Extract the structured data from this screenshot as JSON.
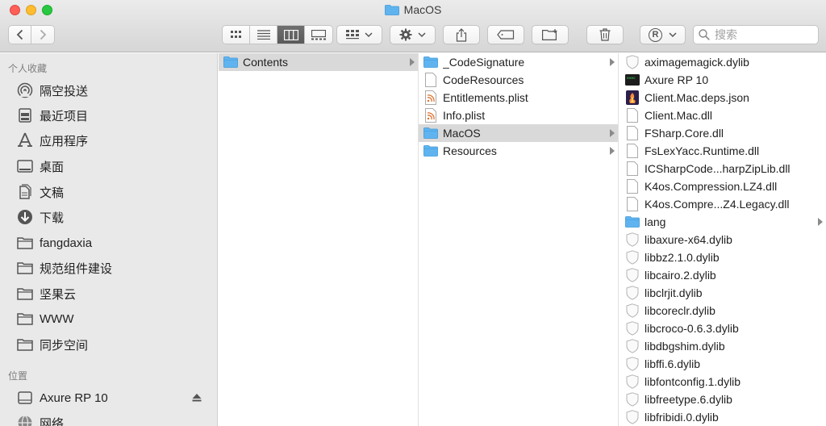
{
  "window": {
    "title": "MacOS"
  },
  "toolbar": {
    "search_placeholder": "搜索",
    "tag_letter": "R"
  },
  "sidebar": {
    "favorites_header": "个人收藏",
    "favorites": [
      {
        "label": "隔空投送",
        "icon": "airdrop-icon"
      },
      {
        "label": "最近项目",
        "icon": "recents-icon"
      },
      {
        "label": "应用程序",
        "icon": "applications-icon"
      },
      {
        "label": "桌面",
        "icon": "desktop-icon"
      },
      {
        "label": "文稿",
        "icon": "documents-icon"
      },
      {
        "label": "下载",
        "icon": "downloads-icon"
      },
      {
        "label": "fangdaxia",
        "icon": "folder-icon"
      },
      {
        "label": "规范组件建设",
        "icon": "folder-icon"
      },
      {
        "label": "坚果云",
        "icon": "folder-icon"
      },
      {
        "label": "WWW",
        "icon": "folder-icon"
      },
      {
        "label": "同步空间",
        "icon": "folder-icon"
      }
    ],
    "locations_header": "位置",
    "locations": [
      {
        "label": "Axure RP 10",
        "icon": "disk-icon"
      },
      {
        "label": "网络",
        "icon": "network-icon"
      }
    ]
  },
  "columns": {
    "col1": [
      {
        "label": "Contents",
        "type": "folder",
        "selected": true,
        "has_children": true
      }
    ],
    "col2": [
      {
        "label": "_CodeSignature",
        "type": "folder",
        "has_children": true
      },
      {
        "label": "CodeResources",
        "type": "file"
      },
      {
        "label": "Entitlements.plist",
        "type": "plist"
      },
      {
        "label": "Info.plist",
        "type": "plist"
      },
      {
        "label": "MacOS",
        "type": "folder",
        "selected": true,
        "has_children": true
      },
      {
        "label": "Resources",
        "type": "folder",
        "has_children": true
      }
    ],
    "col3": [
      {
        "label": "aximagemagick.dylib",
        "type": "dylib"
      },
      {
        "label": "Axure RP 10",
        "type": "exec"
      },
      {
        "label": "Client.Mac.deps.json",
        "type": "json"
      },
      {
        "label": "Client.Mac.dll",
        "type": "file"
      },
      {
        "label": "FSharp.Core.dll",
        "type": "file"
      },
      {
        "label": "FsLexYacc.Runtime.dll",
        "type": "file"
      },
      {
        "label": "ICSharpCode...harpZipLib.dll",
        "type": "file"
      },
      {
        "label": "K4os.Compression.LZ4.dll",
        "type": "file"
      },
      {
        "label": "K4os.Compre...Z4.Legacy.dll",
        "type": "file"
      },
      {
        "label": "lang",
        "type": "folder",
        "has_children": true
      },
      {
        "label": "libaxure-x64.dylib",
        "type": "dylib"
      },
      {
        "label": "libbz2.1.0.dylib",
        "type": "dylib"
      },
      {
        "label": "libcairo.2.dylib",
        "type": "dylib"
      },
      {
        "label": "libclrjit.dylib",
        "type": "dylib"
      },
      {
        "label": "libcoreclr.dylib",
        "type": "dylib"
      },
      {
        "label": "libcroco-0.6.3.dylib",
        "type": "dylib"
      },
      {
        "label": "libdbgshim.dylib",
        "type": "dylib"
      },
      {
        "label": "libffi.6.dylib",
        "type": "dylib"
      },
      {
        "label": "libfontconfig.1.dylib",
        "type": "dylib"
      },
      {
        "label": "libfreetype.6.dylib",
        "type": "dylib"
      },
      {
        "label": "libfribidi.0.dylib",
        "type": "dylib"
      }
    ]
  },
  "colors": {
    "folder": "#5fb4f0",
    "selection": "#d9d9d9",
    "sidebar_bg": "#e9e9e9"
  }
}
